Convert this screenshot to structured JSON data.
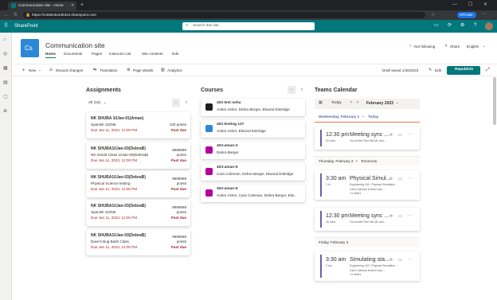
{
  "browser": {
    "tab_title": "Communication site - Home",
    "url": "https://m365edu435324.sharepoint.com",
    "profile_label": "InPrivate"
  },
  "suite": {
    "app_name": "SharePoint",
    "search_placeholder": "Search this site"
  },
  "site": {
    "logo_initials": "Cs",
    "title": "Communication site",
    "nav": [
      "Home",
      "Documents",
      "Pages",
      "Instructor List",
      "Site contents",
      "Edit"
    ],
    "follow_label": "Not following",
    "share_label": "Share",
    "language_label": "English"
  },
  "command_bar": {
    "new_label": "New",
    "discard_label": "Discard changes",
    "translation_label": "Translation",
    "page_details_label": "Page details",
    "analytics_label": "Analytics",
    "draft_status": "Draft saved 1/30/2023",
    "edit_label": "Edit",
    "republish_label": "Republish"
  },
  "assignments": {
    "heading": "Assignments",
    "filter": "All (16)",
    "items": [
      {
        "title": "NK SHUBA 10Jan-01(Aman)",
        "class": "Spanish 102NK",
        "points": "100 points",
        "due": "Due Jan 11, 2023, 12:00 PM",
        "status": "Past due"
      },
      {
        "title": "NK SHUBA10Jan-03(DebraB)",
        "class": "NK SHUB Class 10Jan-09(DebraB)",
        "points": "9999999 points",
        "due": "Due Jan 11, 2023, 12:00 PM",
        "status": "Past due"
      },
      {
        "title": "NK SHUBA10Jan-03(DebraB)",
        "class": "Physical Science testing",
        "points": "9999999 points",
        "due": "Due Jan 11, 2023, 12:00 PM",
        "status": "Past due"
      },
      {
        "title": "NK SHUBA10Jan-03(DebraB)",
        "class": "Spanish 102NK",
        "points": "9999999 points",
        "due": "Due Jan 11, 2023, 12:00 PM",
        "status": "Past due"
      },
      {
        "title": "NK SHUBA10Jan-03(DebraB)",
        "class": "Dave's Bug Bash Class",
        "points": "9999999 points",
        "due": "Due Jan 11, 2023, 12:00 PM",
        "status": "Past due"
      }
    ]
  },
  "courses": {
    "heading": "Courses",
    "items": [
      {
        "name": "403 test neha",
        "members": "Arden Asher, Debra Berger, Elwood Eskridge",
        "color": "#1f1f1f"
      },
      {
        "name": "403 testing 137",
        "members": "Arden Asher, Elwood Eskridge",
        "color": "#2b88d8"
      },
      {
        "name": "403-aman-3",
        "members": "Debra Berger",
        "color": "#b4009e"
      },
      {
        "name": "403-aman-5",
        "members": "Cara Coleman, Debra Berger, Elwood Eskridge",
        "color": "#b4009e"
      },
      {
        "name": "403-aman-6",
        "members": "Arden Asher, Cara Coleman, Debra Berger, Elw...",
        "color": "#b4009e"
      }
    ]
  },
  "calendar": {
    "heading": "Teams Calendar",
    "today_label": "Today",
    "month_label": "February 2023",
    "days": [
      {
        "label": "Wednesday, February 1",
        "tag": "Today"
      },
      {
        "label": "Thursday, February 2",
        "tag": "Tomorrow"
      },
      {
        "label": "Friday, February 3",
        "tag": ""
      }
    ],
    "events": [
      {
        "time": "12:30 pm",
        "duration": "30 mins",
        "title": "Meeting sync ...",
        "sub": "You invited Test Site ML and ..."
      },
      {
        "time": "3:30 am",
        "duration": "1 hr",
        "title": "Physical Simul...",
        "sub": "Engineering 101 / Physical Simulation",
        "sub2": "Cara Coleman invited Cara ...",
        "sub3": "+4 others"
      },
      {
        "time": "12:30 pm",
        "duration": "30 mins",
        "title": "Meeting sync ...",
        "sub": "You invited Test Site ML and ..."
      },
      {
        "time": "3:30 am",
        "duration": "2 hrs",
        "title": "Simulating sta...",
        "sub": "Engineering 101 / Physical Simulation",
        "sub2": "Cara Coleman invited Cara ...",
        "sub3": "+4 others"
      }
    ]
  },
  "colors": {
    "accent": "#03787c",
    "past_due": "#a4262c",
    "event_bar": "#6264a7"
  }
}
